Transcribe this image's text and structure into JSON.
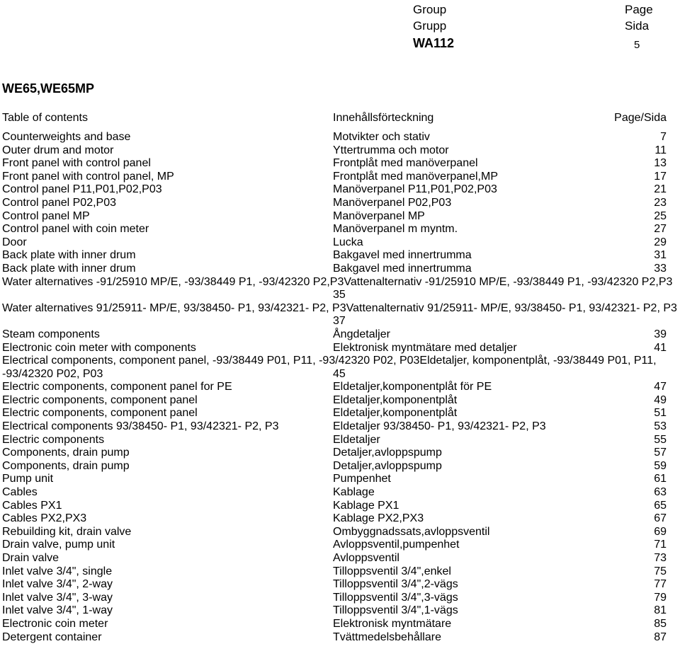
{
  "header": {
    "group_label_en": "Group",
    "group_label_sv": "Grupp",
    "group_value": "WA112",
    "page_label_en": "Page",
    "page_label_sv": "Sida",
    "page_value": "5"
  },
  "model_title": "WE65,WE65MP",
  "toc": {
    "head": {
      "en": "Table of contents",
      "sv": "Innehållsförteckning",
      "page": "Page/Sida"
    },
    "rows": [
      {
        "en": "Counterweights and base",
        "sv": "Motvikter och stativ",
        "page": "7",
        "tall": false
      },
      {
        "en": "Outer drum and motor",
        "sv": "Yttertrumma och motor",
        "page": "11",
        "tall": false
      },
      {
        "en": "Front panel with control panel",
        "sv": "Frontplåt med manöverpanel",
        "page": "13",
        "tall": false
      },
      {
        "en": "Front panel with control panel, MP",
        "sv": "Frontplåt med manöverpanel,MP",
        "page": "17",
        "tall": false
      },
      {
        "en": "Control panel P11,P01,P02,P03",
        "sv": "Manöverpanel P11,P01,P02,P03",
        "page": "21",
        "tall": false
      },
      {
        "en": "Control panel P02,P03",
        "sv": "Manöverpanel P02,P03",
        "page": "23",
        "tall": false
      },
      {
        "en": "Control panel MP",
        "sv": "Manöverpanel MP",
        "page": "25",
        "tall": false
      },
      {
        "en": "Control panel with coin meter",
        "sv": "Manöverpanel m myntm.",
        "page": "27",
        "tall": false
      },
      {
        "en": "Door",
        "sv": "Lucka",
        "page": "29",
        "tall": false
      },
      {
        "en": "Back plate with inner drum",
        "sv": "Bakgavel med innertrumma",
        "page": "31",
        "tall": false
      },
      {
        "en": "Back plate with inner drum",
        "sv": "Bakgavel med innertrumma",
        "page": "33",
        "tall": false
      },
      {
        "en": "Water alternatives -91/25910 MP/E, -93/38449 P1, -93/42320 P2,P3",
        "sv": "Vattenalternativ -91/25910 MP/E, -93/38449 P1, -93/42320 P2,P3",
        "page": "35",
        "tall": true
      },
      {
        "en": "Water alternatives 91/25911- MP/E, 93/38450- P1, 93/42321- P2, P3",
        "sv": "Vattenalternativ 91/25911- MP/E, 93/38450- P1, 93/42321- P2, P3",
        "page": "37",
        "tall": true
      },
      {
        "en": "Steam components",
        "sv": "Ångdetaljer",
        "page": "39",
        "tall": false
      },
      {
        "en": "Electronic coin meter with components",
        "sv": "Elektronisk myntmätare med detaljer",
        "page": "41",
        "tall": false
      },
      {
        "en": "Electrical components, component panel, -93/38449 P01, P11, -93/42320 P02, P03",
        "sv": "Eldetaljer, komponentplåt, -93/38449 P01, P11, -93/42320 P02, P03",
        "page": "45",
        "tall": true
      },
      {
        "en": "Electric components, component panel for PE",
        "sv": "Eldetaljer,komponentplåt för PE",
        "page": "47",
        "tall": false
      },
      {
        "en": "Electric components, component panel",
        "sv": "Eldetaljer,komponentplåt",
        "page": "49",
        "tall": false
      },
      {
        "en": "Electric components, component panel",
        "sv": "Eldetaljer,komponentplåt",
        "page": "51",
        "tall": false
      },
      {
        "en": "Electrical components 93/38450- P1, 93/42321- P2, P3",
        "sv": "Eldetaljer 93/38450- P1, 93/42321- P2, P3",
        "page": "53",
        "tall": false
      },
      {
        "en": "Electric components",
        "sv": "Eldetaljer",
        "page": "55",
        "tall": false
      },
      {
        "en": "Components, drain pump",
        "sv": "Detaljer,avloppspump",
        "page": "57",
        "tall": false
      },
      {
        "en": "Components, drain pump",
        "sv": "Detaljer,avloppspump",
        "page": "59",
        "tall": false
      },
      {
        "en": "Pump unit",
        "sv": "Pumpenhet",
        "page": "61",
        "tall": false
      },
      {
        "en": "Cables",
        "sv": "Kablage",
        "page": "63",
        "tall": false
      },
      {
        "en": "Cables PX1",
        "sv": "Kablage PX1",
        "page": "65",
        "tall": false
      },
      {
        "en": "Cables PX2,PX3",
        "sv": "Kablage PX2,PX3",
        "page": "67",
        "tall": false
      },
      {
        "en": "Rebuilding kit, drain valve",
        "sv": "Ombyggnadssats,avloppsventil",
        "page": "69",
        "tall": false
      },
      {
        "en": "Drain valve, pump unit",
        "sv": "Avloppsventil,pumpenhet",
        "page": "71",
        "tall": false
      },
      {
        "en": "Drain valve",
        "sv": "Avloppsventil",
        "page": "73",
        "tall": false
      },
      {
        "en": "Inlet valve 3/4\", single",
        "sv": "Tilloppsventil 3/4\",enkel",
        "page": "75",
        "tall": false
      },
      {
        "en": "Inlet valve 3/4\", 2-way",
        "sv": "Tilloppsventil 3/4\",2-vägs",
        "page": "77",
        "tall": false
      },
      {
        "en": "Inlet valve 3/4\", 3-way",
        "sv": "Tilloppsventil 3/4\",3-vägs",
        "page": "79",
        "tall": false
      },
      {
        "en": "Inlet valve 3/4\", 1-way",
        "sv": "Tilloppsventil 3/4\",1-vägs",
        "page": "81",
        "tall": false
      },
      {
        "en": "Electronic coin meter",
        "sv": "Elektronisk myntmätare",
        "page": "85",
        "tall": false
      },
      {
        "en": "Detergent container",
        "sv": "Tvättmedelsbehållare",
        "page": "87",
        "tall": false
      }
    ]
  }
}
